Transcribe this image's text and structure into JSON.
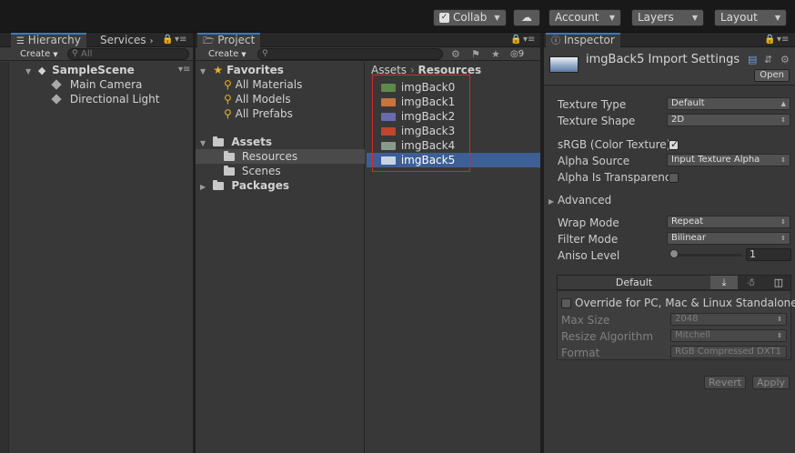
{
  "toolbar": {
    "collab_label": "Collab",
    "account_label": "Account",
    "layers_label": "Layers",
    "layout_label": "Layout"
  },
  "hierarchy": {
    "tab_label": "Hierarchy",
    "services_label": "Services",
    "create_label": "Create",
    "search_placeholder": "All",
    "scene_name": "SampleScene",
    "items": [
      {
        "label": "Main Camera"
      },
      {
        "label": "Directional Light"
      }
    ]
  },
  "project": {
    "tab_label": "Project",
    "create_label": "Create",
    "hidden_count": "9",
    "favorites_label": "Favorites",
    "favorites": [
      {
        "label": "All Materials"
      },
      {
        "label": "All Models"
      },
      {
        "label": "All Prefabs"
      }
    ],
    "assets_label": "Assets",
    "asset_folders": [
      {
        "label": "Resources"
      },
      {
        "label": "Scenes"
      }
    ],
    "packages_label": "Packages",
    "breadcrumb": {
      "root": "Assets",
      "current": "Resources"
    },
    "files": [
      {
        "label": "imgBack0",
        "color": "#5c8a4a"
      },
      {
        "label": "imgBack1",
        "color": "#c8743a"
      },
      {
        "label": "imgBack2",
        "color": "#6a6ab0"
      },
      {
        "label": "imgBack3",
        "color": "#c0452a"
      },
      {
        "label": "imgBack4",
        "color": "#8a9a8a"
      },
      {
        "label": "imgBack5",
        "color": "#c6d4e6"
      }
    ],
    "selected_file": "imgBack5"
  },
  "inspector": {
    "tab_label": "Inspector",
    "title": "imgBack5 Import Settings",
    "open_label": "Open",
    "texture_type_label": "Texture Type",
    "texture_type_value": "Default",
    "texture_shape_label": "Texture Shape",
    "texture_shape_value": "2D",
    "srgb_label": "sRGB (Color Texture)",
    "alpha_source_label": "Alpha Source",
    "alpha_source_value": "Input Texture Alpha",
    "alpha_transparency_label": "Alpha Is Transparency",
    "advanced_label": "Advanced",
    "wrap_mode_label": "Wrap Mode",
    "wrap_mode_value": "Repeat",
    "filter_mode_label": "Filter Mode",
    "filter_mode_value": "Bilinear",
    "aniso_label": "Aniso Level",
    "aniso_value": "1",
    "platform_default_label": "Default",
    "override_label": "Override for PC, Mac & Linux Standalone",
    "max_size_label": "Max Size",
    "max_size_value": "2048",
    "resize_label": "Resize Algorithm",
    "resize_value": "Mitchell",
    "format_label": "Format",
    "format_value": "RGB Compressed DXT1",
    "revert_label": "Revert",
    "apply_label": "Apply"
  }
}
